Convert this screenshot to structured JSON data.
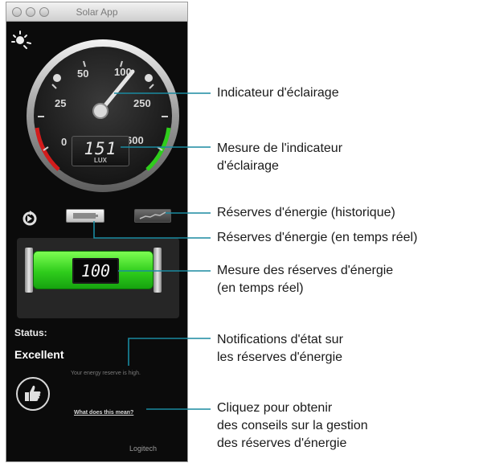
{
  "window": {
    "title": "Solar App"
  },
  "gauge": {
    "ticks": [
      "0",
      "25",
      "50",
      "100",
      "250",
      "600"
    ],
    "value": "151",
    "unit": "LUX"
  },
  "battery": {
    "readout": "100"
  },
  "status": {
    "label": "Status:",
    "value": "Excellent",
    "message": "Your energy reserve is high.",
    "help_link": "What does this mean?"
  },
  "brand": "Logitech",
  "icons": {
    "sun": "sun-icon",
    "refresh": "refresh-icon",
    "realtime": "realtime-battery-icon",
    "history": "history-graph-icon",
    "thumb": "thumbs-up-icon"
  },
  "colors": {
    "accent_green": "#2fcd1c",
    "gauge_red": "#d21c1c",
    "background": "#0b0b0b"
  },
  "callouts": [
    {
      "text": "Indicateur d'éclairage"
    },
    {
      "text": "Mesure de l'indicateur\nd'éclairage"
    },
    {
      "text": "Réserves d'énergie (historique)"
    },
    {
      "text": "Réserves d'énergie (en temps réel)"
    },
    {
      "text": "Mesure des réserves d'énergie\n(en temps réel)"
    },
    {
      "text": "Notifications d'état sur\nles réserves d'énergie"
    },
    {
      "text": "Cliquez pour obtenir\ndes conseils sur la gestion\ndes réserves d'énergie"
    }
  ]
}
